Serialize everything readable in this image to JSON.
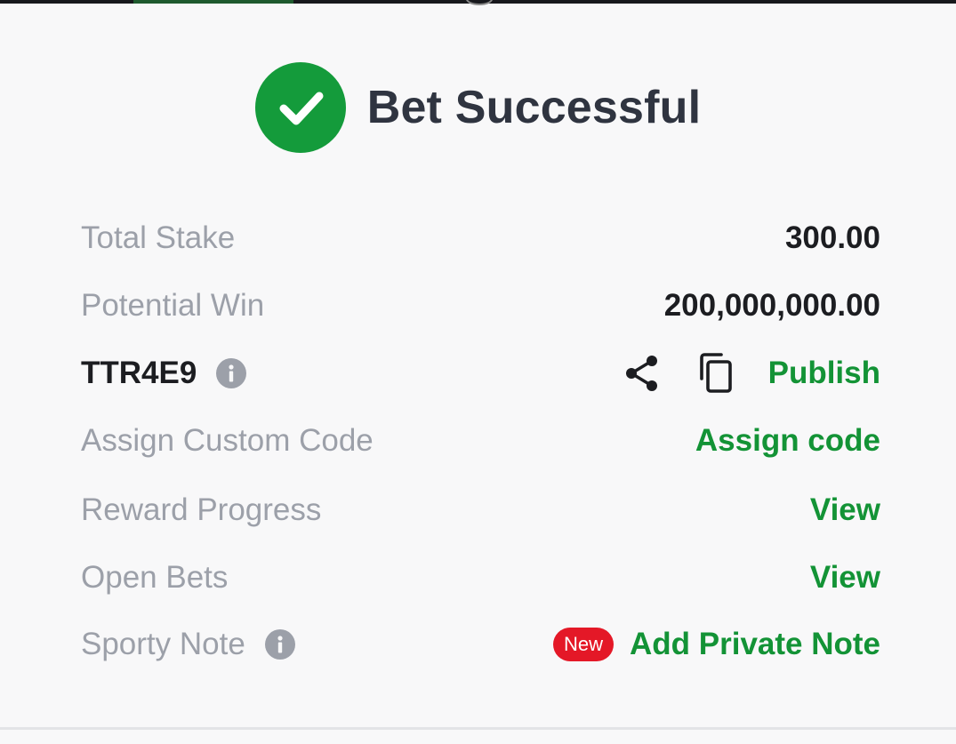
{
  "header": {
    "title": "Bet Successful",
    "icon": "check-circle-icon",
    "icon_color": "#149b3b"
  },
  "rows": {
    "total_stake": {
      "label": "Total Stake",
      "value": "300.00"
    },
    "potential_win": {
      "label": "Potential Win",
      "value": "200,000,000.00"
    },
    "booking": {
      "code": "TTR4E9",
      "info_icon": "info-icon",
      "share_icon": "share-icon",
      "copy_icon": "copy-icon",
      "publish_label": "Publish"
    },
    "custom_code": {
      "label": "Assign Custom Code",
      "action": "Assign code"
    },
    "reward_progress": {
      "label": "Reward Progress",
      "action": "View"
    },
    "open_bets": {
      "label": "Open Bets",
      "action": "View"
    },
    "sporty_note": {
      "label": "Sporty Note",
      "info_icon": "info-icon",
      "badge": "New",
      "action": "Add Private Note"
    }
  },
  "colors": {
    "accent_green": "#139336",
    "label_gray": "#9ca0a9",
    "value_dark": "#1c1d21",
    "badge_red": "#e41827",
    "background": "#f8f8f9"
  }
}
